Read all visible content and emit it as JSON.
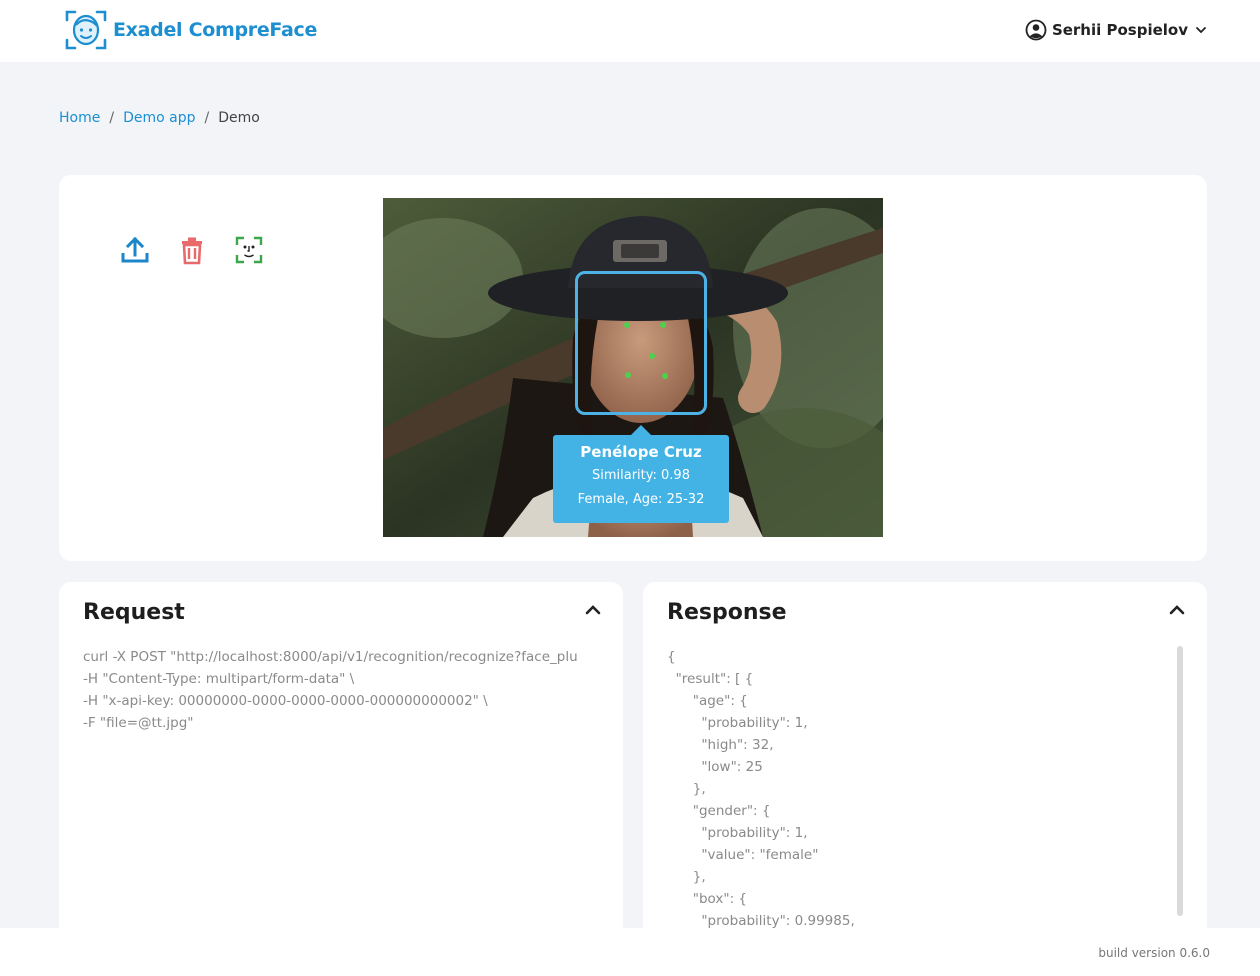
{
  "header": {
    "brand": "Exadel CompreFace",
    "user_name": "Serhii Pospielov"
  },
  "breadcrumb": {
    "home": "Home",
    "app": "Demo app",
    "current": "Demo",
    "separator": "/"
  },
  "toolbar": {
    "icons": [
      "upload-icon",
      "delete-icon",
      "face-recognition-icon"
    ]
  },
  "result": {
    "name": "Penélope Cruz",
    "similarity": "Similarity: 0.98",
    "demographics": "Female, Age: 25-32"
  },
  "request": {
    "title": "Request",
    "code": "curl -X POST \"http://localhost:8000/api/v1/recognition/recognize?face_plu\n-H \"Content-Type: multipart/form-data\" \\\n-H \"x-api-key: 00000000-0000-0000-0000-000000000002\" \\\n-F \"file=@tt.jpg\""
  },
  "response": {
    "title": "Response",
    "code": "{\n  \"result\": [ {\n      \"age\": {\n        \"probability\": 1,\n        \"high\": 32,\n        \"low\": 25\n      },\n      \"gender\": {\n        \"probability\": 1,\n        \"value\": \"female\"\n      },\n      \"box\": {\n        \"probability\": 0.99985,"
  },
  "footer": {
    "build": "build version 0.6.0"
  },
  "colors": {
    "brand": "#1d8fd0",
    "face_box": "#4db3e6",
    "tooltip": "#43b3e6",
    "delete": "#e86a6a",
    "recognize": "#3aa84a"
  }
}
